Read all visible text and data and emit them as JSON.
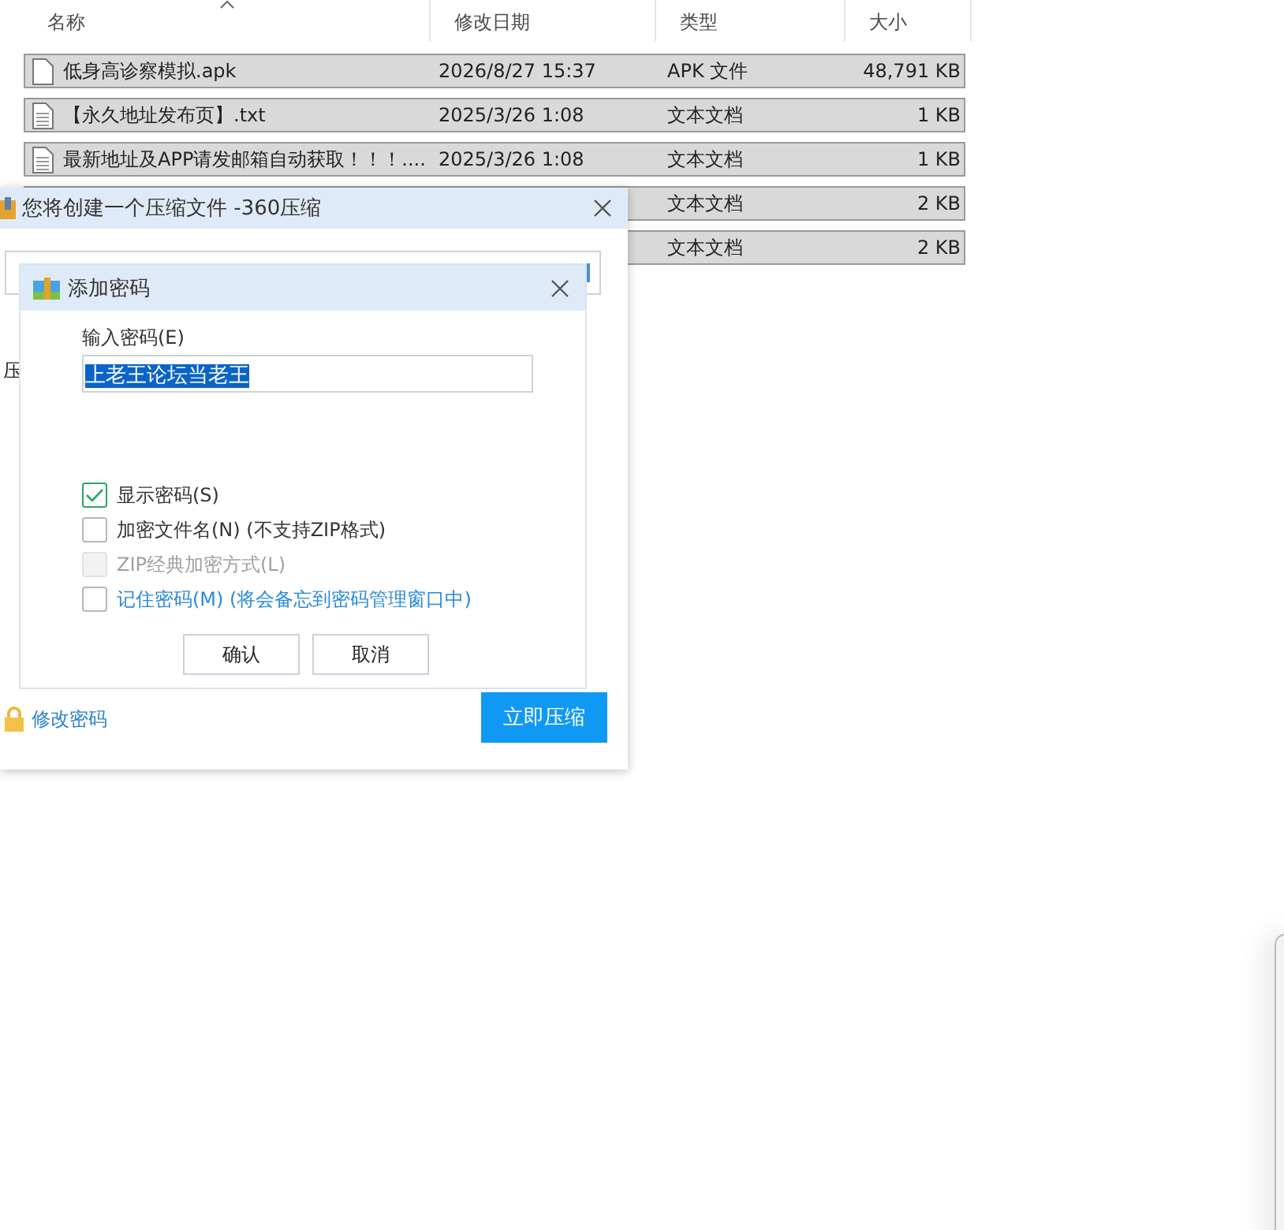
{
  "file_list": {
    "columns": [
      {
        "label": "名称",
        "sorted": true
      },
      {
        "label": "修改日期",
        "sorted": false
      },
      {
        "label": "类型",
        "sorted": false
      },
      {
        "label": "大小",
        "sorted": false
      }
    ],
    "rows": [
      {
        "kind": "apk",
        "name": "低身高诊察模拟.apk",
        "modified": "2026/8/27 15:37",
        "type": "APK 文件",
        "size": "48,791 KB",
        "selected": true
      },
      {
        "kind": "txt",
        "name": "【永久地址发布页】.txt",
        "modified": "2025/3/26 1:08",
        "type": "文本文档",
        "size": "1 KB",
        "selected": true
      },
      {
        "kind": "txt",
        "name": "最新地址及APP请发邮箱自动获取！！！....",
        "modified": "2025/3/26 1:08",
        "type": "文本文档",
        "size": "1 KB",
        "selected": true
      },
      {
        "kind": "hidden",
        "type": "文本文档",
        "size": "2 KB",
        "selected": true
      },
      {
        "kind": "hidden",
        "type": "文本文档",
        "size": "2 KB",
        "selected": true
      }
    ]
  },
  "compress_dialog": {
    "title": "您将创建一个压缩文件 -360压缩",
    "label": "压",
    "change_password_link": "修改密码",
    "primary_button": "立即压缩"
  },
  "password_dialog": {
    "title": "添加密码",
    "field_label": "输入密码(E)",
    "password": "上老王论坛当老王",
    "options": [
      {
        "kind": "plain",
        "label": "显示密码(S)",
        "checked": true,
        "disabled": false
      },
      {
        "kind": "plain",
        "label": "加密文件名(N) (不支持ZIP格式)",
        "checked": false,
        "disabled": false
      },
      {
        "kind": "plain",
        "label": "ZIP经典加密方式(L)",
        "checked": false,
        "disabled": true
      },
      {
        "kind": "link",
        "label": "记住密码(M) (将会备忘到密码管理窗口中)",
        "checked": false,
        "disabled": false
      }
    ],
    "buttons": [
      "确认",
      "取消"
    ]
  }
}
